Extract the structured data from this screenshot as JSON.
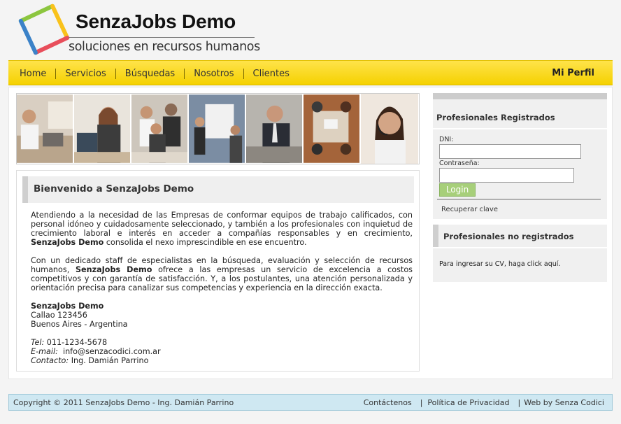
{
  "brand": {
    "title": "SenzaJobs Demo",
    "subtitle": "soluciones en recursos humanos",
    "colors": {
      "red": "#e84e5b",
      "blue": "#3b82c8",
      "green": "#8cc63f",
      "yellow": "#f9c21b"
    }
  },
  "nav": {
    "items": [
      {
        "label": "Home"
      },
      {
        "label": "Servicios"
      },
      {
        "label": "Búsquedas"
      },
      {
        "label": "Nosotros"
      },
      {
        "label": "Clientes"
      }
    ],
    "profile": "Mi Perfil",
    "accent": "#f5d100"
  },
  "welcome": {
    "title": "Bienvenido a SenzaJobs Demo",
    "p1_text": "Atendiendo a la necesidad de las Empresas de conformar equipos de trabajo calificados, con personal idóneo y cuidadosamente seleccionado, y también a los profesionales con inquietud de crecimiento laboral e interés en acceder a compañías responsables y en crecimiento, ",
    "p1_bold": "SenzaJobs Demo",
    "p1_end": " consolida el nexo imprescindible en ese encuentro.",
    "p2_text": "Con un dedicado staff de especialistas en la búsqueda, evaluación y selección de recursos humanos, ",
    "p2_bold": "SenzaJobs Demo",
    "p2_end": " ofrece a las empresas un servicio de excelencia a costos competitivos y con garantía de satisfacción. Y, a los postulantes, una atención personalizada y orientación precisa para canalizar sus competencias y experiencia en la dirección exacta.",
    "company": "SenzaJobs Demo",
    "address": "Callao 123456",
    "city": "Buenos Aires - Argentina",
    "tel_label": "Tel:",
    "tel": "011-1234-5678",
    "email_label": "E-mail:",
    "email": "info@senzacodici.com.ar",
    "contact_label": "Contacto:",
    "contact": "Ing. Damián Parrino"
  },
  "login": {
    "title": "Profesionales Registrados",
    "dni_label": "DNI:",
    "dni_value": "",
    "password_label": "Contraseña:",
    "password_value": "",
    "button": "Login",
    "recover": "Recuperar clave"
  },
  "unregistered": {
    "title": "Profesionales no registrados",
    "text": "Para ingresar su CV, haga ",
    "link": "click aquí",
    "end": "."
  },
  "footer": {
    "copyright": "Copyright © 2011 SenzaJobs Demo - Ing. Damián Parrino",
    "contact": "Contáctenos",
    "sep": "|",
    "privacy": "Política de Privacidad",
    "web_by": "Web by",
    "web_by_name": "Senza Codici"
  }
}
